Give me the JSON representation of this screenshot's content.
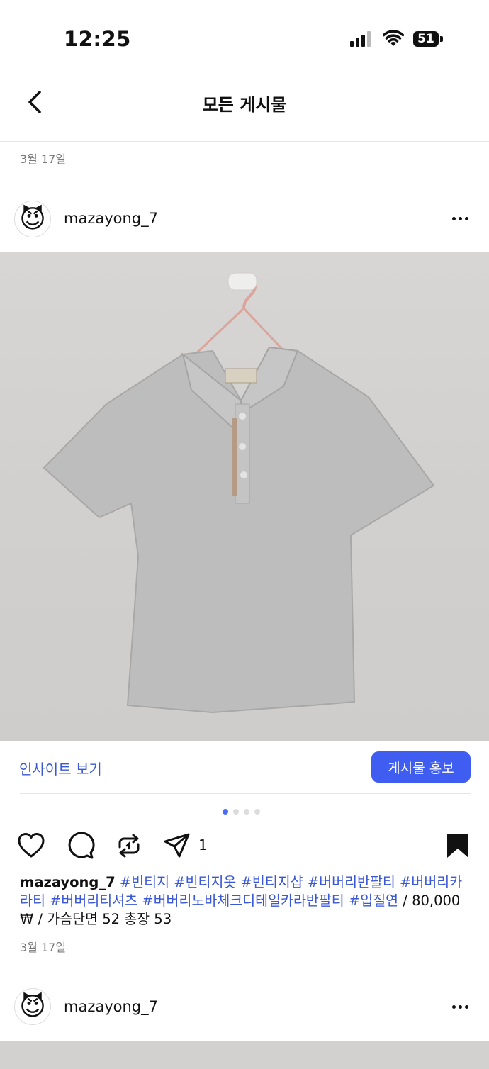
{
  "status_bar": {
    "time": "12:25",
    "battery": "51"
  },
  "header": {
    "title": "모든 게시물"
  },
  "section_date": "3월 17일",
  "post": {
    "username": "mazayong_7",
    "avatar_emoji": "😈",
    "insight_label": "인사이트 보기",
    "promote_label": "게시물 홍보",
    "carousel_count": 4,
    "carousel_active": 0,
    "share_count": "1",
    "caption": {
      "username": "mazayong_7",
      "tags": [
        "#빈티지",
        "#빈티지옷",
        "#빈티지샵",
        "#버버리반팔티",
        "#버버리카라티",
        "#버버리티셔츠",
        "#버버리노바체크디테일카라반팔티",
        "#입질연"
      ],
      "text": " / 80,000 ₩ / 가슴단면 52 총장 53"
    },
    "date": "3월 17일"
  },
  "next_post": {
    "username": "mazayong_7",
    "avatar_emoji": "😈"
  },
  "colors": {
    "accent": "#3f5df0",
    "link": "#3a57d6"
  },
  "icons": [
    "back-chevron-icon",
    "more-icon",
    "heart-icon",
    "comment-icon",
    "repost-icon",
    "share-icon",
    "bookmark-icon",
    "signal-icon",
    "wifi-icon",
    "battery-icon"
  ]
}
